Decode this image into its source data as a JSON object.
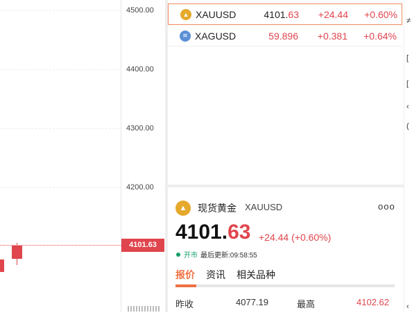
{
  "chart": {
    "y_ticks": [
      "4500.00",
      "4400.00",
      "4300.00",
      "4200.00"
    ],
    "current_price": "4101.63",
    "colors": {
      "down": "#e0454d",
      "grid": "#ececec"
    }
  },
  "watchlist": [
    {
      "icon": "gold-icon",
      "icon_color": "#e5a92c",
      "symbol": "XAUUSD",
      "price_main": "4101.",
      "price_dec": "63",
      "change": "+24.44",
      "pct": "+0.60%"
    },
    {
      "icon": "silver-icon",
      "icon_color": "#5b8fd6",
      "symbol": "XAGUSD",
      "price_main": "59.896",
      "price_dec": "",
      "change": "+0.381",
      "pct": "+0.64%"
    }
  ],
  "detail": {
    "name": "现货黄金",
    "code": "XAUUSD",
    "more": "ooo",
    "price_main": "4101.",
    "price_dec": "63",
    "change": "+24.44 (+0.60%)",
    "status": "开市",
    "last_update": "最后更新:09:58:55",
    "tabs": [
      "报价",
      "资讯",
      "相关品种"
    ],
    "stats": [
      {
        "label": "昨收",
        "value": "4077.19"
      },
      {
        "label": "最高",
        "value": "4102.62"
      }
    ]
  },
  "edge_glyphs": [
    "≠",
    "[",
    "[",
    "‹",
    "(",
    "‹"
  ]
}
